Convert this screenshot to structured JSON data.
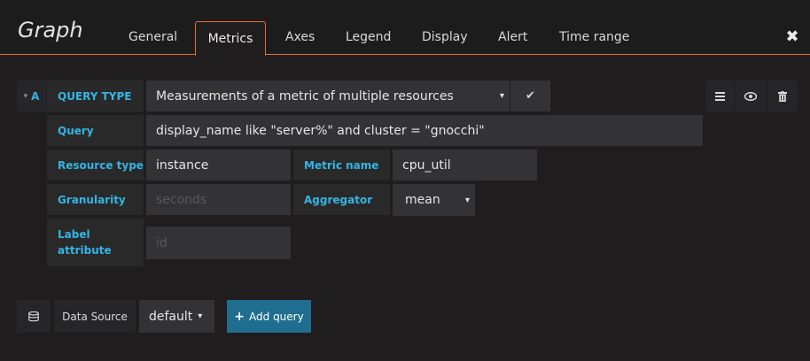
{
  "header": {
    "title": "Graph",
    "tabs": [
      "General",
      "Metrics",
      "Axes",
      "Legend",
      "Display",
      "Alert",
      "Time range"
    ],
    "active_tab": "Metrics",
    "close_glyph": "✖"
  },
  "query": {
    "ref_id": "A",
    "ref_caret": "▾",
    "query_type_label": "QUERY TYPE",
    "query_type_value": "Measurements of a metric of multiple resources",
    "query_type_caret": "▾",
    "confirm_glyph": "✔",
    "query_label": "Query",
    "query_value": "display_name like \"server%\" and cluster = \"gnocchi\"",
    "resource_type_label": "Resource type",
    "resource_type_value": "instance",
    "metric_name_label": "Metric name",
    "metric_name_value": "cpu_util",
    "granularity_label": "Granularity",
    "granularity_placeholder": "seconds",
    "aggregator_label": "Aggregator",
    "aggregator_value": "mean",
    "aggregator_caret": "▾",
    "label_attr_label_1": "Label",
    "label_attr_label_2": "attribute",
    "label_attr_placeholder": "id",
    "actions": {
      "menu_icon": "hamburger-icon",
      "eye_icon": "eye-icon",
      "trash_icon": "trash-icon"
    }
  },
  "footer": {
    "datasource_label": "Data Source",
    "datasource_value": "default",
    "datasource_caret": "▾",
    "add_query_plus": "+",
    "add_query_label": "Add query"
  },
  "colors": {
    "accent": "#e8702a",
    "label_blue": "#33b5e5",
    "primary_button": "#1f6e8f"
  }
}
